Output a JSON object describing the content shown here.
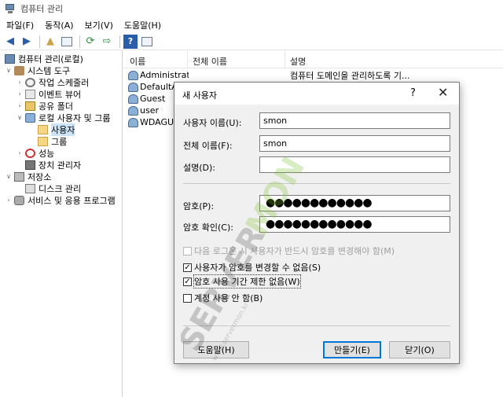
{
  "window": {
    "title": "컴퓨터 관리"
  },
  "menu": [
    "파일(F)",
    "동작(A)",
    "보기(V)",
    "도움말(H)"
  ],
  "toolbar": [
    "back-arrow",
    "forward-arrow",
    "up-folder",
    "show-hide-tree",
    "refresh",
    "export-list",
    "help",
    "properties"
  ],
  "tree": [
    {
      "label": "컴퓨터 관리(로컬)",
      "icon": "computer-icon",
      "chevron": ""
    },
    {
      "label": "시스템 도구",
      "icon": "tools-icon",
      "chevron": "v"
    },
    {
      "label": "작업 스케줄러",
      "icon": "clock-icon",
      "chevron": ">"
    },
    {
      "label": "이벤트 뷰어",
      "icon": "log-icon",
      "chevron": ">"
    },
    {
      "label": "공유 폴더",
      "icon": "share-icon",
      "chevron": ">"
    },
    {
      "label": "로컬 사용자 및 그룹",
      "icon": "users-icon",
      "chevron": "v"
    },
    {
      "label": "사용자",
      "icon": "folder-icon",
      "chevron": ""
    },
    {
      "label": "그룹",
      "icon": "folder-icon",
      "chevron": ""
    },
    {
      "label": "성능",
      "icon": "performance-icon",
      "chevron": ">"
    },
    {
      "label": "장치 관리자",
      "icon": "device-icon",
      "chevron": ""
    },
    {
      "label": "저장소",
      "icon": "storage-icon",
      "chevron": "v"
    },
    {
      "label": "디스크 관리",
      "icon": "disk-icon",
      "chevron": ""
    },
    {
      "label": "서비스 및 응용 프로그램",
      "icon": "services-icon",
      "chevron": ">"
    }
  ],
  "list": {
    "columns": [
      "이름",
      "전체 이름",
      "설명"
    ],
    "rows": [
      {
        "name": "Administrator",
        "full_name": "",
        "description": "컴퓨터 도메인을 관리하도록 기..."
      },
      {
        "name": "DefaultAcc",
        "full_name": "",
        "description": ""
      },
      {
        "name": "Guest",
        "full_name": "",
        "description": ""
      },
      {
        "name": "user",
        "full_name": "",
        "description": ""
      },
      {
        "name": "WDAGUtil",
        "full_name": "",
        "description": ""
      }
    ]
  },
  "dialog": {
    "title": "새 사용자",
    "help": "?",
    "close": "✕",
    "fields": {
      "username_label": "사용자 이름(U):",
      "username_value": "smon",
      "fullname_label": "전체 이름(F):",
      "fullname_value": "smon",
      "description_label": "설명(D):",
      "description_value": "",
      "password_label": "암호(P):",
      "password_value": "●●●●●●●●●●●●",
      "confirm_label": "암호 확인(C):",
      "confirm_value": "●●●●●●●●●●●●"
    },
    "checkboxes": [
      {
        "label": "다음 로그온 시 사용자가 반드시 암호를 변경해야 함(M)",
        "checked": false,
        "disabled": true,
        "focused": false
      },
      {
        "label": "사용자가 암호를 변경할 수 없음(S)",
        "checked": true,
        "disabled": false,
        "focused": false
      },
      {
        "label": "암호 사용 기간 제한 없음(W)",
        "checked": true,
        "disabled": false,
        "focused": true
      },
      {
        "label": "계정 사용 안 함(B)",
        "checked": false,
        "disabled": false,
        "focused": false
      }
    ],
    "buttons": {
      "help": "도움말(H)",
      "create": "만들기(E)",
      "close": "닫기(O)"
    }
  },
  "watermark": {
    "text_server": "SERVER",
    "text_mon": "MON",
    "text_small": "www.servermon.kr"
  },
  "colors": {
    "selection": "#cce4f7",
    "default_button": "#0078d7",
    "watermark_green": "#7bbf2a"
  }
}
